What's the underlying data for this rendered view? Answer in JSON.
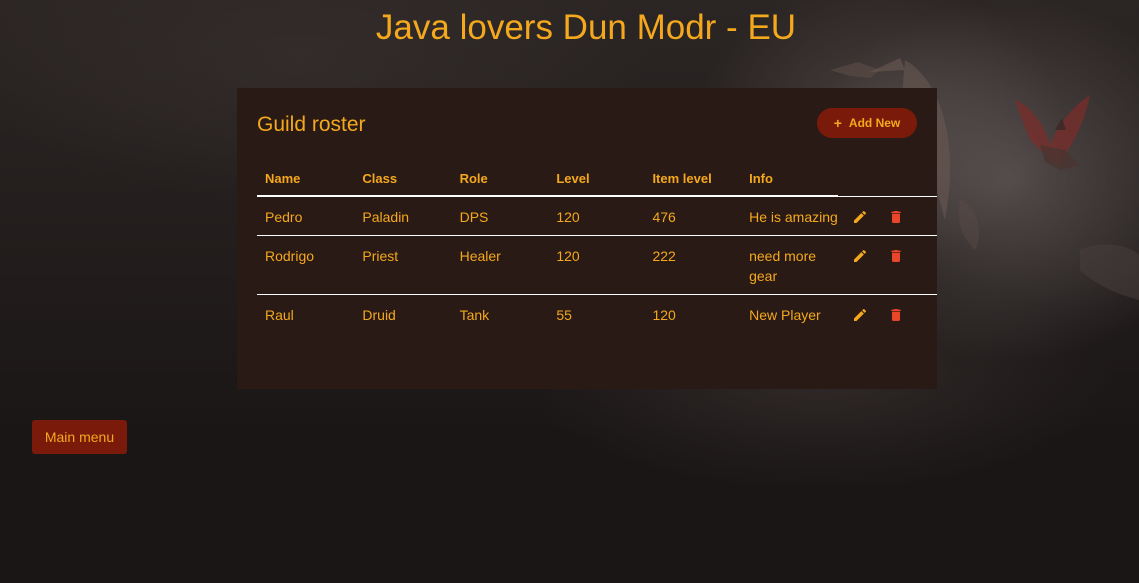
{
  "page": {
    "title": "Java lovers Dun Modr - EU"
  },
  "roster": {
    "title": "Guild roster",
    "add_button_label": "Add New",
    "add_button_icon": "plus-icon",
    "columns": [
      "Name",
      "Class",
      "Role",
      "Level",
      "Item level",
      "Info"
    ],
    "rows": [
      {
        "name": "Pedro",
        "class": "Paladin",
        "role": "DPS",
        "level": "120",
        "item_level": "476",
        "info": "He is amazing"
      },
      {
        "name": "Rodrigo",
        "class": "Priest",
        "role": "Healer",
        "level": "120",
        "item_level": "222",
        "info": "need more gear"
      },
      {
        "name": "Raul",
        "class": "Druid",
        "role": "Tank",
        "level": "55",
        "item_level": "120",
        "info": "New Player"
      }
    ],
    "row_actions": {
      "edit_icon": "pencil-icon",
      "delete_icon": "trash-icon"
    }
  },
  "footer": {
    "main_menu_label": "Main menu"
  },
  "colors": {
    "accent": "#f4a81d",
    "button_bg": "#7a1a0a",
    "card_bg": "#2a1a15",
    "delete_icon": "#e8452a",
    "edit_icon": "#f4a81d"
  }
}
